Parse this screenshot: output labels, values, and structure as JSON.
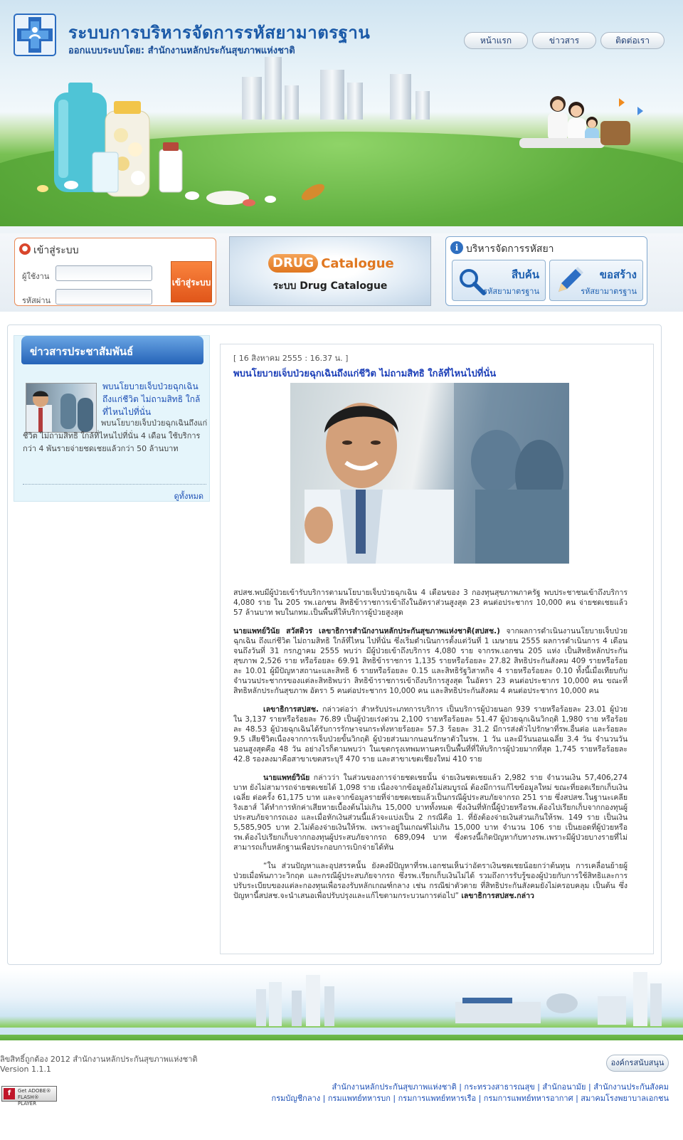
{
  "header": {
    "title": "ระบบการบริหารจัดการรหัสยามาตรฐาน",
    "subtitle": "ออกแบบระบบโดย: สำนักงานหลักประกันสุขภาพแห่งชาติ",
    "nav": [
      {
        "label": "หน้าแรก"
      },
      {
        "label": "ข่าวสาร"
      },
      {
        "label": "ติดต่อเรา"
      }
    ]
  },
  "login": {
    "title": "เข้าสู่ระบบ",
    "username_label": "ผู้ใช้งาน",
    "password_label": "รหัสผ่าน",
    "username_value": "",
    "password_value": "",
    "submit_label": "เข้าสู่ระบบ"
  },
  "drug_banner": {
    "logo_prefix": "DRUG",
    "logo_suffix": "Catalogue",
    "subtitle": "ระบบ Drug Catalogue"
  },
  "manage": {
    "title": "บริหารจัดการรหัสยา",
    "buttons": [
      {
        "label": "สืบค้น",
        "sub": "รหัสยามาตรฐาน",
        "icon": "magnifier-icon"
      },
      {
        "label": "ขอสร้าง",
        "sub": "รหัสยามาตรฐาน",
        "icon": "pencil-icon"
      }
    ]
  },
  "sidebar": {
    "heading": "ข่าวสารประชาสัมพันธ์",
    "news_title": "พบนโยบายเจ็บป่วยฉุกเฉินถึงแก่ชีวิต ไม่ถามสิทธิ ใกล้ที่ไหนไปที่นั่น",
    "news_summary": "พบนโยบายเจ็บป่วยฉุกเฉินถึงแก่ชีวิต ไม่ถามสิทธิ ใกล้ที่ไหนไปที่นั่น 4 เดือน ใช้บริการกว่า 4 พันรายจ่ายชดเชยแล้วกว่า 50 ล้านบาท",
    "view_all": "ดูทั้งหมด"
  },
  "article": {
    "date": "[ 16 สิงหาคม 2555 : 16.37 น. ]",
    "title": "พบนโยบายเจ็บป่วยฉุกเฉินถึงแก่ชีวิต ไม่ถามสิทธิ ใกล้ที่ไหนไปที่นั่น",
    "p1": "สปสช.พบมีผู้ป่วยเข้ารับบริการตามนโยบายเจ็บป่วยฉุกเฉิน 4 เดือนของ 3 กองทุนสุขภาพภาครัฐ พบประชาชนเข้าถึงบริการ 4,080 ราย ใน 205 รพ.เอกชน สิทธิข้าราชการเข้าถึงในอัตราส่วนสูงสุด 23 คนต่อประชากร 10,000 คน จ่ายชดเชยแล้ว 57 ล้านบาท พบในกทม.เป็นพื้นที่ให้บริการผู้ป่วยสูงสุด",
    "p2_lead": "นายแพทย์วินัย สวัสดิวร เลขาธิการสำนักงานหลักประกันสุขภาพแห่งชาติ(สปสช.)",
    "p2": "จากผลการดำเนินงานนโยบายเจ็บป่วยฉุกเฉิน ถึงแก่ชีวิต ไม่ถามสิทธิ ใกล้ที่ไหน ไปที่นั่น ซึ่งเริ่มดำเนินการตั้งแต่วันที่ 1 เมษายน 2555 ผลการดำเนินการ 4 เดือน จนถึงวันที่ 31 กรกฎาคม 2555 พบว่า มีผู้ป่วยเข้าถึงบริการ 4,080 ราย จากรพ.เอกชน 205 แห่ง เป็นสิทธิหลักประกันสุขภาพ 2,526 ราย หรือร้อยละ 69.91 สิทธิข้าราชการ 1,135 รายหรือร้อยละ 27.82 สิทธิประกันสังคม 409 รายหรือร้อยละ 10.01 ผู้มีปัญหาสถานะและสิทธิ 6 รายหรือร้อยละ 0.15 และสิทธิรัฐวิสาหกิจ 4 รายหรือร้อยละ 0.10 ทั้งนี้เมื่อเทียบกับจำนวนประชากรของแต่ละสิทธิพบว่า สิทธิข้าราชการเข้าถึงบริการสูงสุด ในอัตรา 23 คนต่อประชากร 10,000 คน ขณะที่สิทธิหลักประกันสุขภาพ อัตรา 5 คนต่อประชากร 10,000 คน และสิทธิประกันสังคม 4 คนต่อประชากร 10,000 คน",
    "p3_lead": "เลขาธิการสปสช.",
    "p3": "กล่าวต่อว่า สำหรับประเภทการบริการ เป็นบริการผู้ป่วยนอก 939 รายหรือร้อยละ 23.01 ผู้ป่วยใน 3,137 รายหรือร้อยละ 76.89 เป็นผู้ป่วยเร่งด่วน 2,100 รายหรือร้อยละ 51.47 ผู้ป่วยฉุกเฉินวิกฤติ 1,980 ราย หรือร้อยละ 48.53 ผู้ป่วยฉุกเฉินได้รับการรักษาจนกระทั่งหายร้อยละ 57.3 ร้อยละ 31.2 มีการส่งตัวไปรักษาที่รพ.อื่นต่อ และร้อยละ 9.5 เสียชีวิตเนื่องจากการเจ็บป่วยขั้นวิกฤติ ผู้ป่วยส่วนมากนอนรักษาตัวในรพ. 1 วัน และมีวันนอนเฉลี่ย 3.4 วัน จำนวนวันนอนสูงสุดคือ 48 วัน อย่างไรก็ตามพบว่า ในเขตกรุงเทพมหานครเป็นพื้นที่ที่ให้บริการผู้ป่วยมากที่สุด 1,745 รายหรือร้อยละ 42.8 รองลงมาคือสาขาเขตสระบุรี 470 ราย และสาขาเขตเชียงใหม่ 410 ราย",
    "p4_lead": "นายแพทย์วินัย",
    "p4": "กล่าวว่า ในส่วนของการจ่ายชดเชยนั้น จ่ายเงินชดเชยแล้ว 2,982 ราย จำนวนเงิน 57,406,274 บาท ยังไม่สามารถจ่ายชดเชยได้ 1,098 ราย เนื่องจากข้อมูลยังไม่สมบูรณ์ ต้องมีการแก้ไขข้อมูลใหม่ ขณะที่ยอดเรียกเก็บเงินเฉลี่ย ต่อครั้ง 61,175 บาท และจากข้อมูลรายที่จ่ายชดเชยแล้วเป็นกรณีผู้ประสบภัยจากรถ 251 ราย ซึ่งสปสช.ในฐานะเคลียริงเฮาส์ ได้ทำการหักค่าเสียหายเบื้องต้นไม่เกิน 15,000 บาททั้งหมด ซึ่งเงินที่หักนี้ผู้ป่วยหรือรพ.ต้องไปเรียกเก็บจากกองทุนผู้ประสบภัยจากรถเอง และเมื่อหักเงินส่วนนี้แล้วจะแบ่งเป็น 2 กรณีคือ 1. ที่ยังต้องจ่ายเงินส่วนเกินให้รพ. 149 ราย เป็นเงิน 5,585,905 บาท 2.ไม่ต้องจ่ายเงินให้รพ. เพราะอยู่ในเกณฑ์ไม่เกิน 15,000 บาท จำนวน 106 ราย เป็นยอดที่ผู้ป่วยหรือรพ.ต้องไปเรียกเก็บจากกองทุนผู้ประสบภัยจากรถ 689,094 บาท ซึ่งตรงนี้เกิดปัญหากับทางรพ.เพราะมีผู้ป่วยบางรายที่ไม่สามารถเก็บหลักฐานเพื่อประกอบการเบิกจ่ายได้ทัน",
    "p5": "“ใน ส่วนปัญหาและอุปสรรคนั้น ยังคงมีปัญหาที่รพ.เอกชนเห็นว่าอัตราเงินชดเชยน้อยกว่าต้นทุน การเคลื่อนย้ายผู้ป่วยเมื่อพ้นภาวะวิกฤต และกรณีผู้ประสบภัยจากรถ ซึ่งรพ.เรียกเก็บเงินไม่ได้ รวมถึงการรับรู้ของผู้ป่วยกับการใช้สิทธิและการปรับระเบียบของแต่ละกองทุนเพื่อรองรับหลักเกณฑ์กลาง เช่น กรณีฆ่าตัวตาย ที่สิทธิประกันสังคมยังไม่ครอบคลุม เป็นต้น ซึ่งปัญหานี้สปสช.จะนำเสนอเพื่อปรับปรุงและแก้ไขตามกระบวนการต่อไป”",
    "p5_tail": "เลขาธิการสปสช.กล่าว"
  },
  "footer": {
    "copyright": "ลิขสิทธิ์ถูกต้อง 2012 สำนักงานหลักประกันสุขภาพแห่งชาติ",
    "version": "Version 1.1.1",
    "support_button": "องค์กรสนับสนุน",
    "flash_badge": "Get ADOBE® FLASH® PLAYER",
    "links_line1": "สำนักงานหลักประกันสุขภาพแห่งชาติ | กระทรวงสาธารณสุข | สำนักอนามัย | สำนักงานประกันสังคม",
    "links_line2": "กรมบัญชีกลาง | กรมแพทย์ทหารบก | กรมการแพทย์ทหารเรือ | กรมการแพทย์ทหารอากาศ | สมาคมโรงพยาบาลเอกชน"
  },
  "colors": {
    "brand_blue": "#1b5aa8",
    "login_border": "#e98b57",
    "login_button": "#e1561a",
    "link_blue": "#1c4fb5",
    "sidebar_bg": "#e5f5fb"
  }
}
